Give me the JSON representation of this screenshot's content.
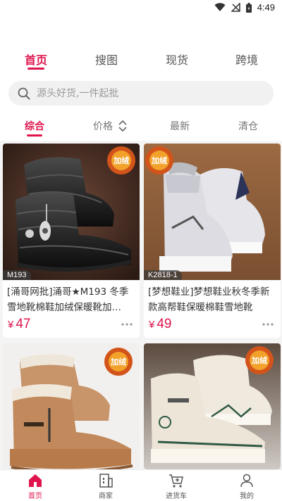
{
  "status_bar": {
    "time": "4:49"
  },
  "top_tabs": [
    {
      "label": "首页"
    },
    {
      "label": "搜图"
    },
    {
      "label": "现货"
    },
    {
      "label": "跨境"
    }
  ],
  "search": {
    "placeholder": "源头好货,一件起批"
  },
  "sort_tabs": [
    {
      "label": "综合"
    },
    {
      "label": "价格"
    },
    {
      "label": "最新"
    },
    {
      "label": "清仓"
    }
  ],
  "products": [
    {
      "sku": "M193",
      "title": "[涌哥网批]涌哥★M193 冬季雪地靴棉鞋加绒保暖靴加…",
      "yen": "¥",
      "price": "47",
      "badge": "加绒"
    },
    {
      "sku": "K2818-1",
      "title": "[梦想鞋业]梦想鞋业秋冬季新款高帮鞋保暖棉鞋雪地靴",
      "yen": "¥",
      "price": "49",
      "badge": "加绒"
    },
    {
      "badge": "加绒"
    },
    {
      "badge": "加绒"
    }
  ],
  "bottom_nav": [
    {
      "label": "首页"
    },
    {
      "label": "商家"
    },
    {
      "label": "进货车"
    },
    {
      "label": "我的"
    }
  ],
  "colors": {
    "accent": "#e0144c",
    "background": "#f4f4f4"
  }
}
